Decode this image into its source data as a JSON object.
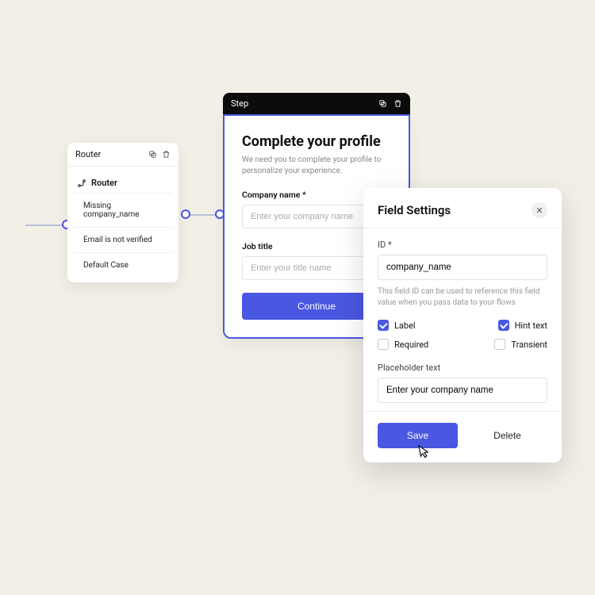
{
  "router": {
    "header_label": "Router",
    "section_title": "Router",
    "items": [
      {
        "label": "Missing company_name"
      },
      {
        "label": "Email is not verified"
      },
      {
        "label": "Default Case"
      }
    ]
  },
  "step": {
    "header_label": "Step",
    "title": "Complete your profile",
    "subtitle": "We need you to complete your profile to personalize your experience.",
    "fields": [
      {
        "label": "Company name *",
        "placeholder": "Enter your company name"
      },
      {
        "label": "Job title",
        "placeholder": "Enter your title name"
      }
    ],
    "continue_label": "Continue"
  },
  "modal": {
    "title": "Field Settings",
    "id_label": "ID *",
    "id_value": "company_name",
    "id_hint": "This field ID can be used to reference this field value when you pass data to your flows",
    "checks": {
      "label": {
        "text": "Label",
        "checked": true
      },
      "hint": {
        "text": "Hint text",
        "checked": true
      },
      "required": {
        "text": "Required",
        "checked": false
      },
      "transient": {
        "text": "Transient",
        "checked": false
      }
    },
    "placeholder_label": "Placeholder text",
    "placeholder_value": "Enter your company name",
    "save_label": "Save",
    "delete_label": "Delete"
  }
}
